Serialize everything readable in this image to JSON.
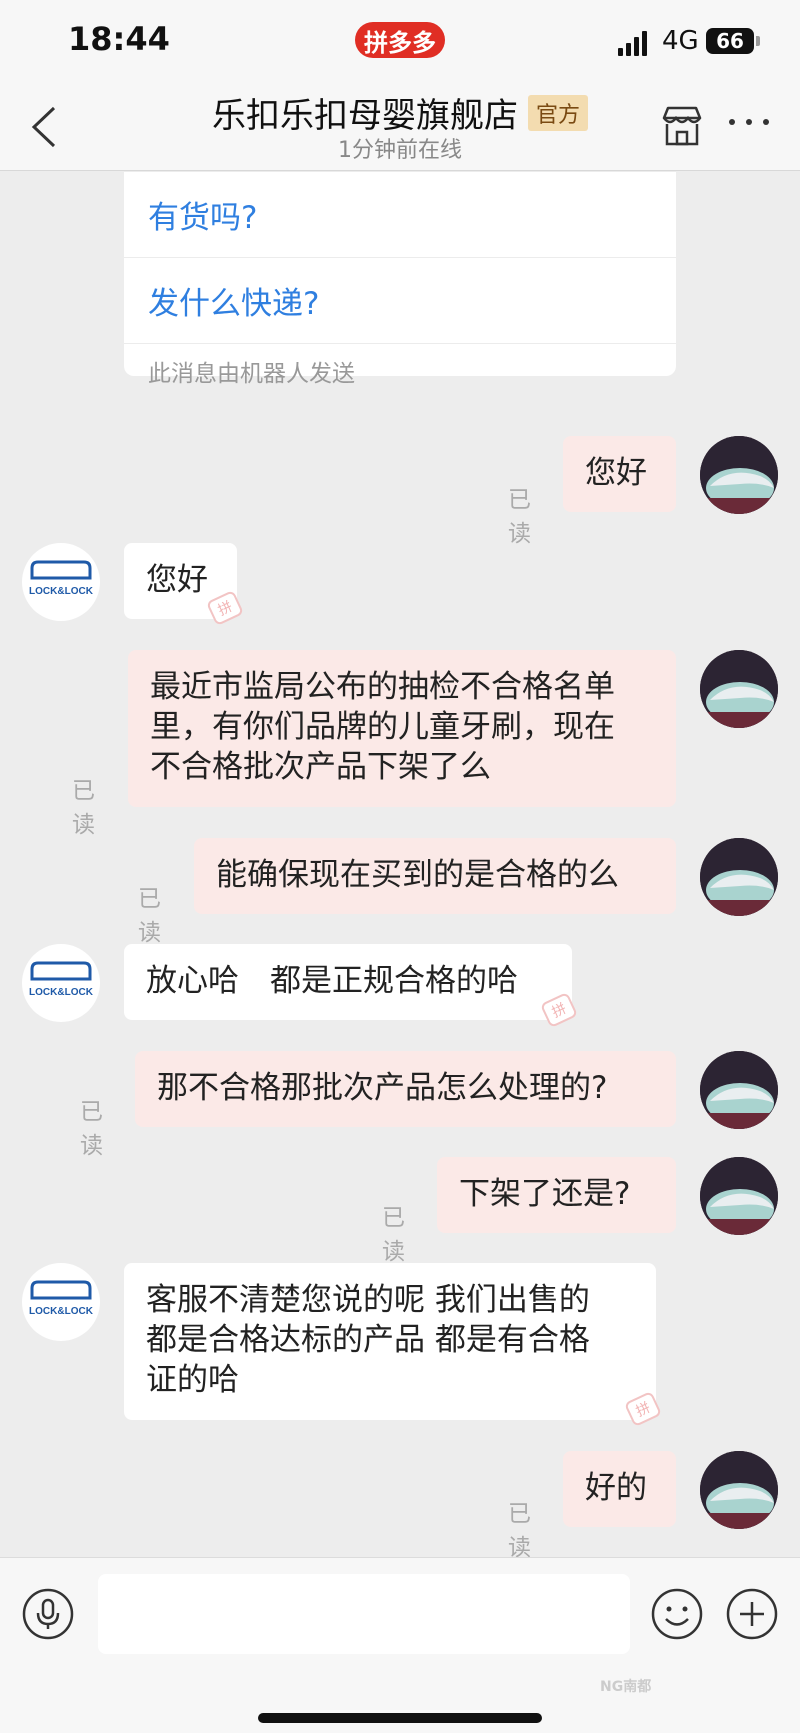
{
  "status_bar": {
    "time": "18:44",
    "app_pill": "拼多多",
    "network": "4G",
    "battery": "66"
  },
  "header": {
    "shop_name": "乐扣乐扣母婴旗舰店",
    "official_badge": "官方",
    "online_status": "1分钟前在线"
  },
  "bot_card": {
    "questions": [
      "有货吗?",
      "发什么快递?"
    ],
    "footer": "此消息由机器人发送"
  },
  "messages": [
    {
      "side": "out",
      "text": "您好",
      "read": "已读"
    },
    {
      "side": "in",
      "text": "您好"
    },
    {
      "side": "out",
      "lines": [
        "最近市监局公布的抽检不合格名单",
        "里，有你们品牌的儿童牙刷，现在",
        "不合格批次产品下架了么"
      ],
      "read": "已读"
    },
    {
      "side": "out",
      "text": "能确保现在买到的是合格的么",
      "read": "已读"
    },
    {
      "side": "in",
      "text": "放心哈　都是正规合格的哈"
    },
    {
      "side": "out",
      "text": "那不合格那批次产品怎么处理的?",
      "read": "已读"
    },
    {
      "side": "out",
      "text": "下架了还是?",
      "read": "已读"
    },
    {
      "side": "in",
      "lines": [
        "客服不清楚您说的呢  我们出售的",
        "都是合格达标的产品  都是有合格",
        "证的哈"
      ]
    },
    {
      "side": "out",
      "text": "好的",
      "read": "已读"
    }
  ],
  "shop_avatar_text": "LOCK&LOCK",
  "input": {
    "placeholder": ""
  },
  "watermark": "NG南都",
  "colors": {
    "accent": "#e02e24",
    "link": "#2f7fe0",
    "out_bubble": "#fbe9e7"
  }
}
